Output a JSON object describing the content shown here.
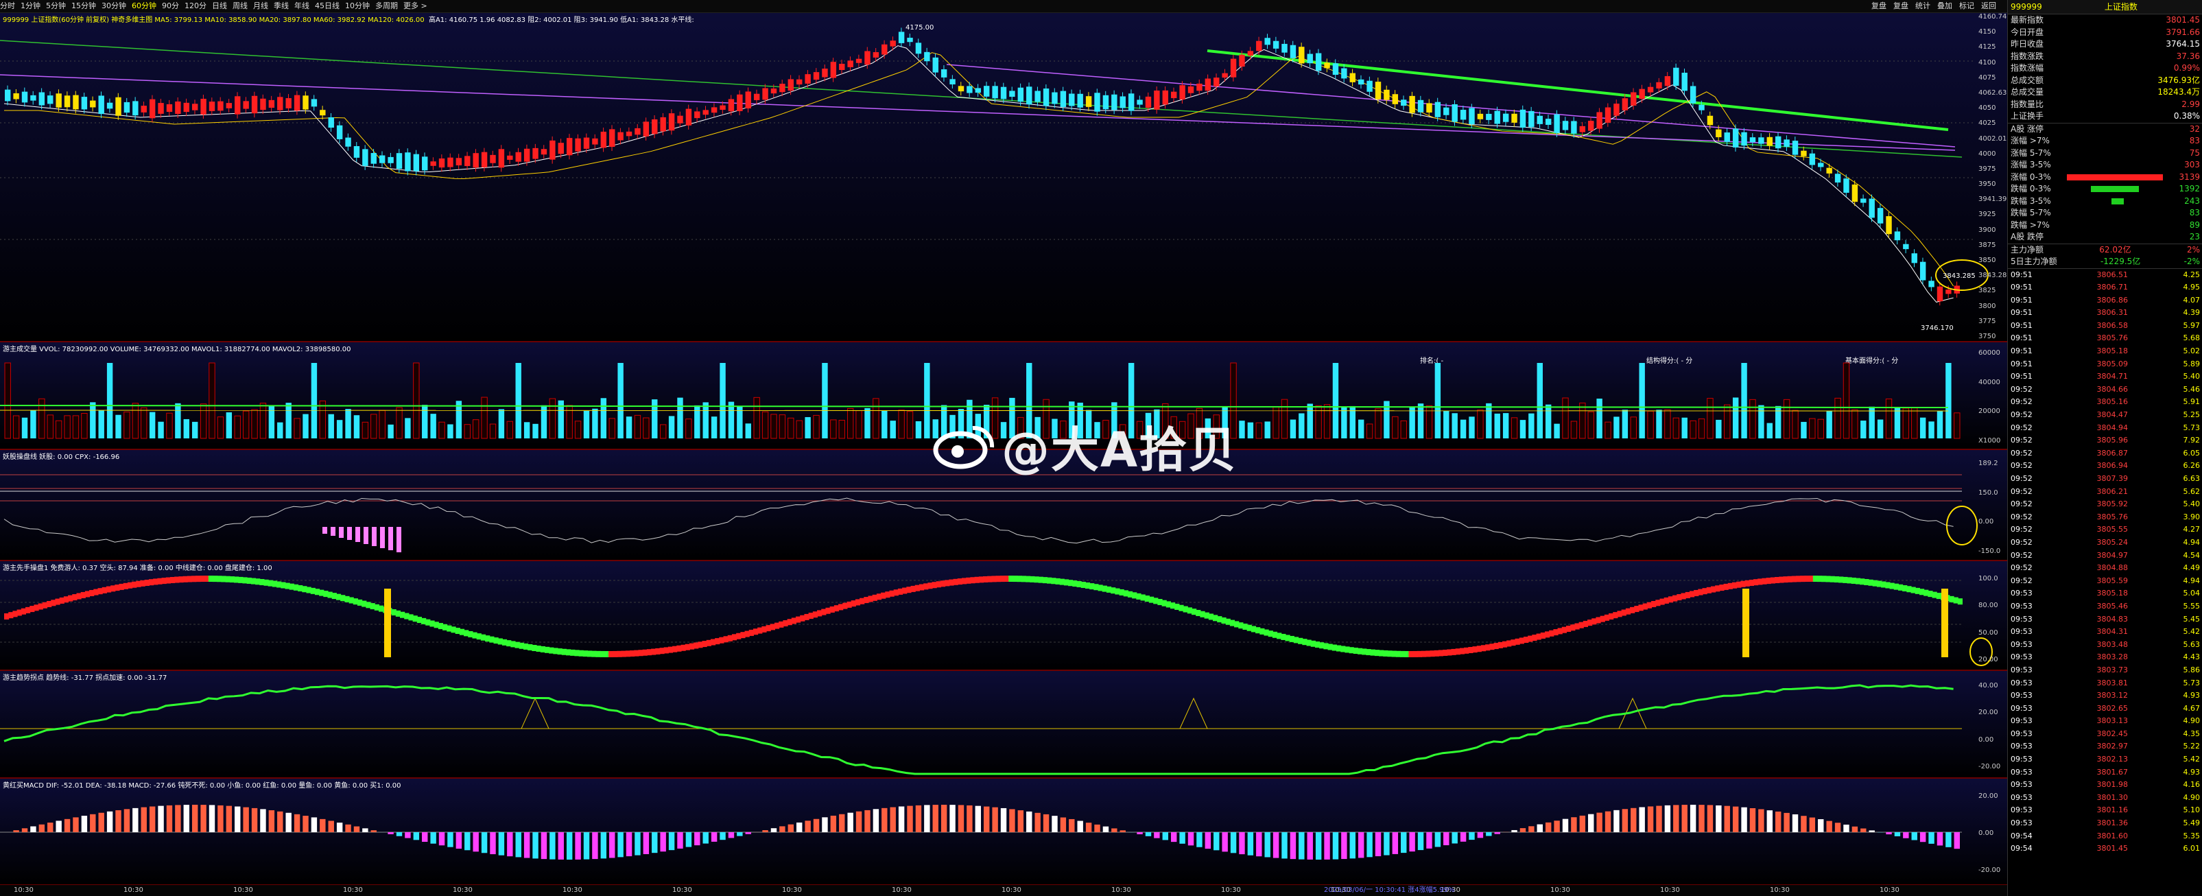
{
  "topbar": {
    "periods": [
      "分时",
      "1分钟",
      "5分钟",
      "15分钟",
      "30分钟",
      "60分钟",
      "90分",
      "120分",
      "日线",
      "周线",
      "月线",
      "季线",
      "年线",
      "45日线",
      "10分钟",
      "多周期",
      "更多 >"
    ],
    "selected": "60分钟",
    "right_tools": [
      "复盘",
      "复盘",
      "统计",
      "叠加",
      "标记",
      "返回"
    ],
    "indicator_line": "999999 上证指数(60分钟 前复权) 神奇多维主图  MA5: 3799.13  MA10: 3858.90  MA20: 3897.80  MA60: 3982.92  MA120: 4026.00",
    "indicator_line2": "高A1: 4160.75  1.96  4082.83  阻2: 4002.01  阻3: 3941.90  低A1: 3843.28  水平线: "
  },
  "main_axis": [
    "4160.745",
    "4150",
    "4125",
    "4100",
    "4075",
    "4062.630",
    "4050",
    "4025",
    "4002.015",
    "4000",
    "3975",
    "3950",
    "3941.399",
    "3925",
    "3900",
    "3875",
    "3850",
    "3843.285",
    "3825",
    "3800",
    "3775",
    "3750"
  ],
  "main_labels": {
    "high": "4175.00",
    "low": "3746.170",
    "last": "3843.285"
  },
  "vol_pane": {
    "header": "游主成交量 VVOL: 78230992.00  VOLUME: 34769332.00  MAVOL1: 31882774.00  MAVOL2: 33898580.00",
    "rank": "排名:(  -",
    "struct": "结构得分:(  - 分",
    "basic": "基本面得分:(  - 分",
    "axis": [
      "60000",
      "40000",
      "20000",
      "X1000"
    ]
  },
  "pane3": {
    "header": "妖股操盘线 妖股: 0.00  CPX: -166.96",
    "axis": [
      "189.2",
      "150.0",
      "0.00",
      "-150.0"
    ]
  },
  "pane4": {
    "header": "游主先手操盘1 免费游人: 0.37  空头: 87.94  准备: 0.00  中线建仓: 0.00  盘尾建仓: 1.00",
    "axis": [
      "100.0",
      "80.00",
      "50.00",
      "20.00"
    ]
  },
  "pane5": {
    "header": "游主趋势拐点 趋势线: -31.77  拐点加速: 0.00  -31.77",
    "axis": [
      "40.00",
      "20.00",
      "0.00",
      "-20.00"
    ]
  },
  "pane6": {
    "header": "黄红买MACD DIF: -52.01  DEA: -38.18  MACD: -27.66  钝死不死: 0.00  小鱼: 0.00  红鱼: 0.00  量鱼: 0.00  黄鱼: 0.00  买1: 0.00",
    "axis": [
      "20.00",
      "0.00",
      "-20.00"
    ]
  },
  "bottom": {
    "date_label": "2025/03/06/一 10:30:41 涨4涨幅5.99%",
    "times": [
      "10:30",
      "10:30",
      "10:30",
      "10:30",
      "10:30",
      "10:30",
      "10:30",
      "10:30",
      "10:30",
      "10:30",
      "10:30",
      "10:30",
      "10:30",
      "10:30",
      "10:30",
      "10:30",
      "10:30",
      "10:30"
    ]
  },
  "watermark": "@大A拾贝",
  "side": {
    "title_code": "999999",
    "title_name": "上证指数",
    "quote": [
      {
        "k": "最新指数",
        "v": "3801.45",
        "c": "red"
      },
      {
        "k": "今日开盘",
        "v": "3791.66",
        "c": "red"
      },
      {
        "k": "昨日收盘",
        "v": "3764.15",
        "c": "wht"
      },
      {
        "k": "指数涨跌",
        "v": "37.36",
        "c": "red"
      },
      {
        "k": "指数涨幅",
        "v": "0.99%",
        "c": "red"
      },
      {
        "k": "总成交额",
        "v": "3476.93亿",
        "c": "yel"
      },
      {
        "k": "总成交量",
        "v": "18243.4万",
        "c": "yel"
      },
      {
        "k": "指数量比",
        "v": "2.99",
        "c": "red"
      },
      {
        "k": "上证换手",
        "v": "0.38%",
        "c": "wht"
      }
    ],
    "breadth": [
      {
        "k": "A股 涨停",
        "v": "32",
        "c": "red",
        "bar": 0
      },
      {
        "k": "涨幅 >7%",
        "v": "83",
        "c": "red",
        "bar": 0
      },
      {
        "k": "涨幅 5-7%",
        "v": "75",
        "c": "red",
        "bar": 0
      },
      {
        "k": "涨幅 3-5%",
        "v": "303",
        "c": "red",
        "bar": 0
      },
      {
        "k": "涨幅 0-3%",
        "v": "3139",
        "c": "red",
        "bar": 140
      },
      {
        "k": "跌幅 0-3%",
        "v": "1392",
        "c": "green",
        "bar": 70
      },
      {
        "k": "跌幅 3-5%",
        "v": "243",
        "c": "green",
        "bar": 18
      },
      {
        "k": "跌幅 5-7%",
        "v": "83",
        "c": "green",
        "bar": 0
      },
      {
        "k": "跌幅 >7%",
        "v": "89",
        "c": "green",
        "bar": 0
      },
      {
        "k": "A股 跌停",
        "v": "23",
        "c": "green",
        "bar": 0
      }
    ],
    "flow": [
      {
        "k": "主力净额",
        "v": "62.02亿",
        "p": "2%",
        "c": "red"
      },
      {
        "k": "5日主力净额",
        "v": "-1229.5亿",
        "p": "-2%",
        "c": "green"
      }
    ],
    "ticks": [
      [
        "09:51",
        "3806.51",
        "4.25"
      ],
      [
        "09:51",
        "3806.71",
        "4.95"
      ],
      [
        "09:51",
        "3806.86",
        "4.07"
      ],
      [
        "09:51",
        "3806.31",
        "4.39"
      ],
      [
        "09:51",
        "3806.58",
        "5.97"
      ],
      [
        "09:51",
        "3805.76",
        "5.68"
      ],
      [
        "09:51",
        "3805.18",
        "5.02"
      ],
      [
        "09:51",
        "3805.09",
        "5.89"
      ],
      [
        "09:51",
        "3804.71",
        "5.40"
      ],
      [
        "09:52",
        "3804.66",
        "5.46"
      ],
      [
        "09:52",
        "3805.16",
        "5.91"
      ],
      [
        "09:52",
        "3804.47",
        "5.25"
      ],
      [
        "09:52",
        "3804.94",
        "5.73"
      ],
      [
        "09:52",
        "3805.96",
        "7.92"
      ],
      [
        "09:52",
        "3806.87",
        "6.05"
      ],
      [
        "09:52",
        "3806.94",
        "6.26"
      ],
      [
        "09:52",
        "3807.39",
        "6.63"
      ],
      [
        "09:52",
        "3806.21",
        "5.62"
      ],
      [
        "09:52",
        "3805.92",
        "5.40"
      ],
      [
        "09:52",
        "3805.76",
        "3.90"
      ],
      [
        "09:52",
        "3805.55",
        "4.27"
      ],
      [
        "09:52",
        "3805.24",
        "4.94"
      ],
      [
        "09:52",
        "3804.97",
        "4.54"
      ],
      [
        "09:52",
        "3804.88",
        "4.49"
      ],
      [
        "09:52",
        "3805.59",
        "4.94"
      ],
      [
        "09:53",
        "3805.18",
        "5.04"
      ],
      [
        "09:53",
        "3805.46",
        "5.55"
      ],
      [
        "09:53",
        "3804.83",
        "5.45"
      ],
      [
        "09:53",
        "3804.31",
        "5.42"
      ],
      [
        "09:53",
        "3803.48",
        "5.63"
      ],
      [
        "09:53",
        "3803.28",
        "4.43"
      ],
      [
        "09:53",
        "3803.73",
        "5.86"
      ],
      [
        "09:53",
        "3803.81",
        "5.73"
      ],
      [
        "09:53",
        "3803.12",
        "4.93"
      ],
      [
        "09:53",
        "3802.65",
        "4.67"
      ],
      [
        "09:53",
        "3803.13",
        "4.90"
      ],
      [
        "09:53",
        "3802.45",
        "4.35"
      ],
      [
        "09:53",
        "3802.97",
        "5.22"
      ],
      [
        "09:53",
        "3802.13",
        "5.42"
      ],
      [
        "09:53",
        "3801.67",
        "4.93"
      ],
      [
        "09:53",
        "3801.98",
        "4.16"
      ],
      [
        "09:53",
        "3801.30",
        "4.90"
      ],
      [
        "09:53",
        "3801.16",
        "5.10"
      ],
      [
        "09:53",
        "3801.36",
        "5.49"
      ],
      [
        "09:54",
        "3801.60",
        "5.35"
      ],
      [
        "09:54",
        "3801.45",
        "6.01"
      ]
    ]
  },
  "colors": {
    "up": "#ff2020",
    "down": "#30e8ff",
    "yellow": "#ffe000",
    "magenta": "#e040ff",
    "green": "#30ff30"
  }
}
